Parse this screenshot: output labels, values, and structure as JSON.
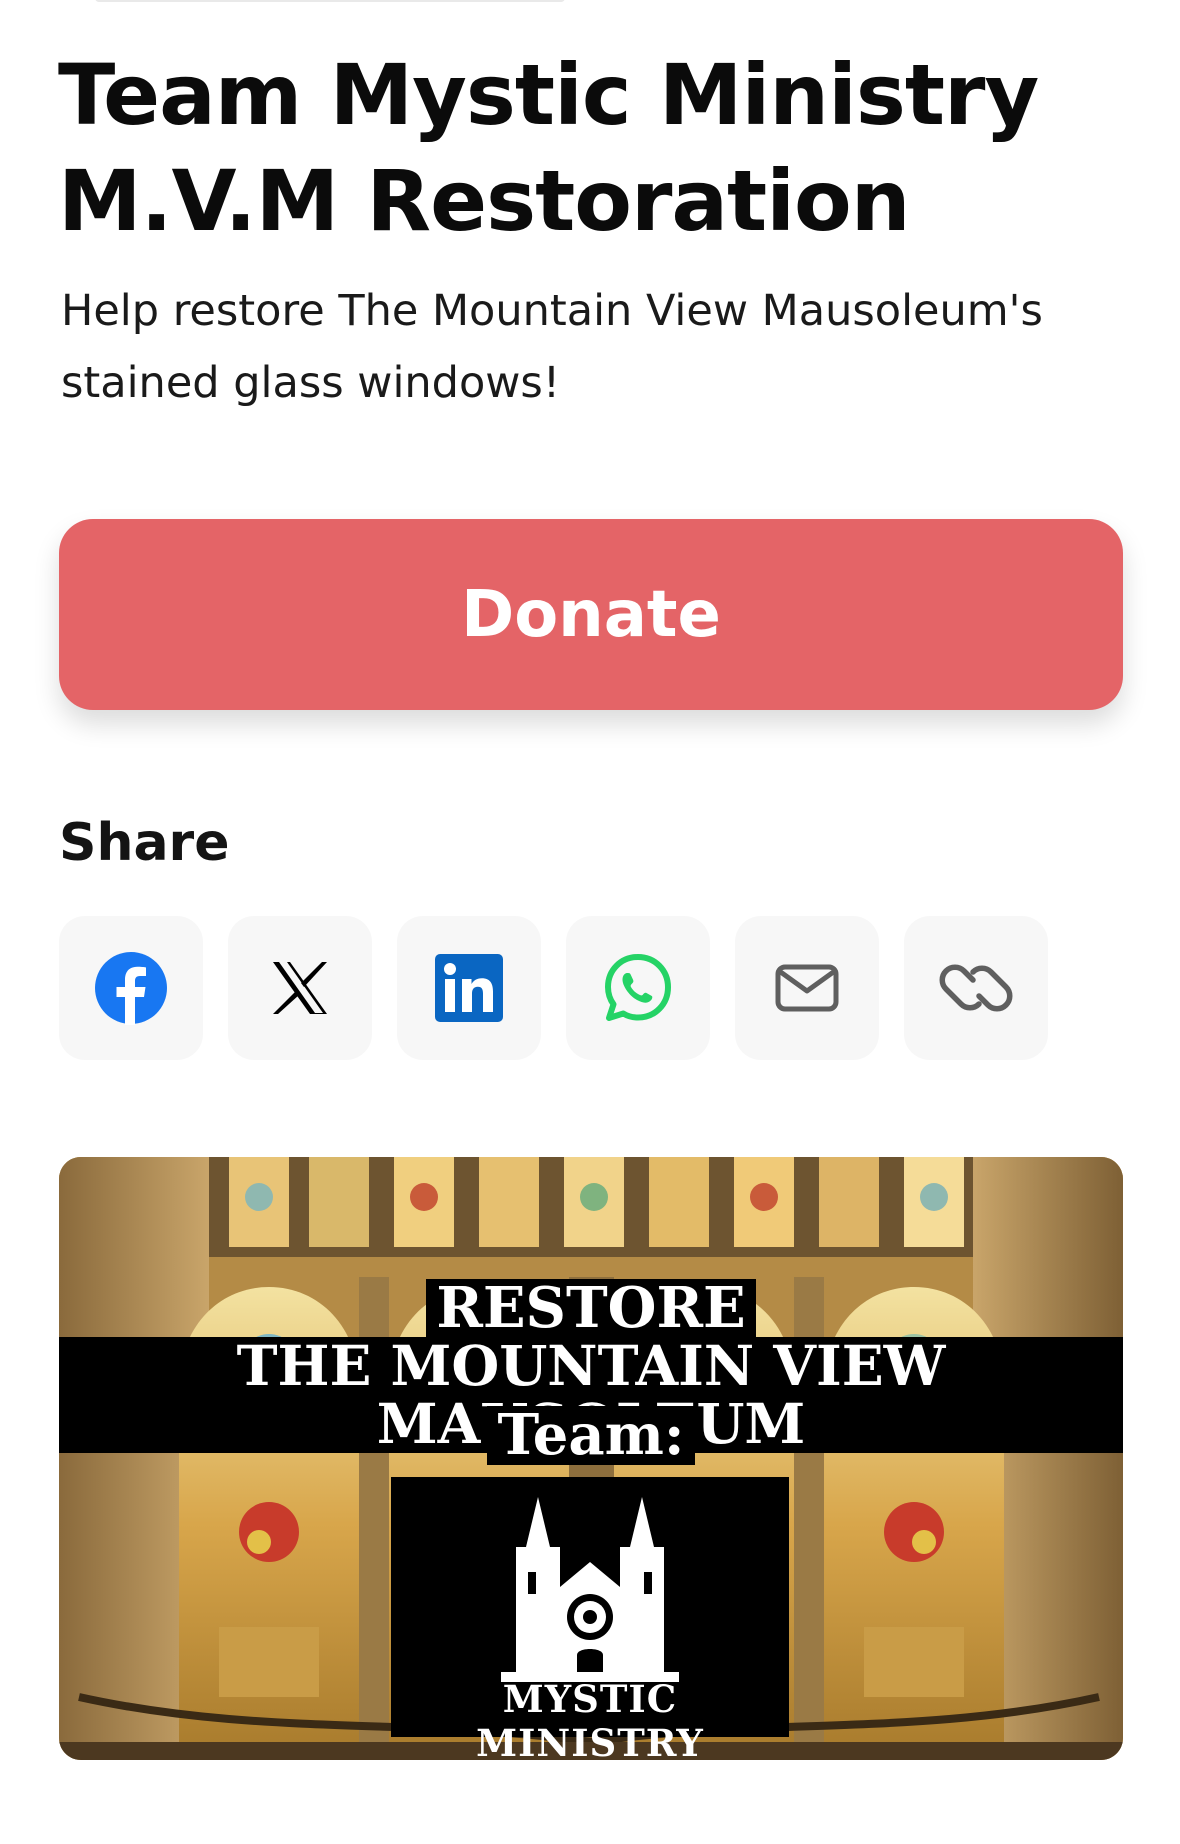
{
  "page": {
    "title": "Team Mystic Ministry M.V.M Restoration",
    "subtitle": "Help restore The Mountain View Mausoleum's stained glass windows!",
    "donate_label": "Donate",
    "share_heading": "Share"
  },
  "share": {
    "items": [
      {
        "name": "facebook",
        "icon": "facebook-icon",
        "color": "#1877F2"
      },
      {
        "name": "x",
        "icon": "x-icon",
        "color": "#000000"
      },
      {
        "name": "linkedin",
        "icon": "linkedin-icon",
        "color": "#0A66C2"
      },
      {
        "name": "whatsapp",
        "icon": "whatsapp-icon",
        "color": "#25D366"
      },
      {
        "name": "email",
        "icon": "mail-icon",
        "color": "#5f5f5f"
      },
      {
        "name": "copy-link",
        "icon": "link-icon",
        "color": "#5f5f5f"
      }
    ]
  },
  "banner": {
    "line1": "RESTORE",
    "line2": "THE MOUNTAIN VIEW MAUSOLEUM",
    "line3": "Team:",
    "logo_caption": "MYSTIC MINISTRY"
  },
  "colors": {
    "donate": "#e46467",
    "share_tile": "#f7f7f7"
  }
}
